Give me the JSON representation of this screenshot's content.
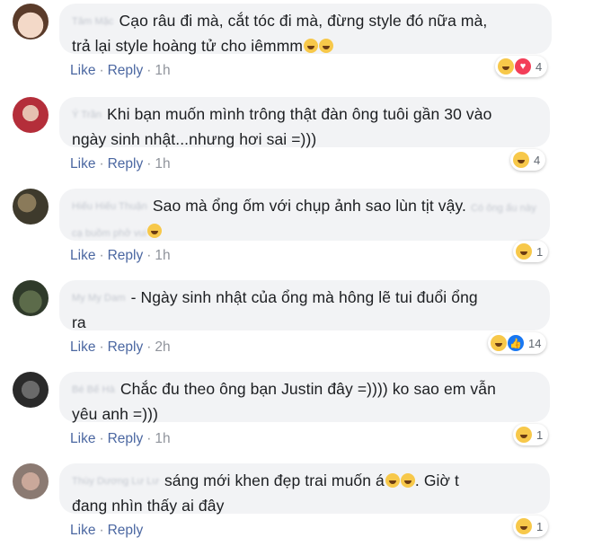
{
  "comments": [
    {
      "text_line1": "Cạo râu đi mà, cắt tóc đi mà, đừng style đó nữa mà,",
      "text_line2": "trả lại style hoàng tử cho iêmmm",
      "like": "Like",
      "reply": "Reply",
      "time": "1h",
      "reaction_count": "4",
      "reactions": [
        "haha",
        "love"
      ]
    },
    {
      "text_line1": "Khi bạn muốn mình trông thật đàn ông tuôi gần 30 vào",
      "text_line2": "ngày sinh nhật...nhưng hơi sai =)))",
      "like": "Like",
      "reply": "Reply",
      "time": "1h",
      "reaction_count": "4",
      "reactions": [
        "haha"
      ]
    },
    {
      "text_line1": "Sao mà ổng ốm với chụp ảnh sao lùn tịt vậy.",
      "text_line2": "",
      "like": "Like",
      "reply": "Reply",
      "time": "1h",
      "reaction_count": "1",
      "reactions": [
        "haha"
      ]
    },
    {
      "text_line1": "- Ngày sinh nhật của ổng mà hông lẽ tui đuổi ổng",
      "text_line2": "ra",
      "like": "Like",
      "reply": "Reply",
      "time": "2h",
      "reaction_count": "14",
      "reactions": [
        "haha",
        "like"
      ]
    },
    {
      "text_line1": "Chắc đu theo ông bạn Justin đây =)))) ko sao em vẫn",
      "text_line2": "yêu anh =)))",
      "like": "Like",
      "reply": "Reply",
      "time": "1h",
      "reaction_count": "1",
      "reactions": [
        "haha"
      ]
    },
    {
      "text_line1": "sáng mới khen đẹp trai muốn á",
      "text_line1b": ". Giờ t",
      "text_line2": "đang nhìn thấy ai đây",
      "like": "Like",
      "reply": "Reply",
      "time": "",
      "reaction_count": "1",
      "reactions": [
        "haha"
      ]
    }
  ]
}
